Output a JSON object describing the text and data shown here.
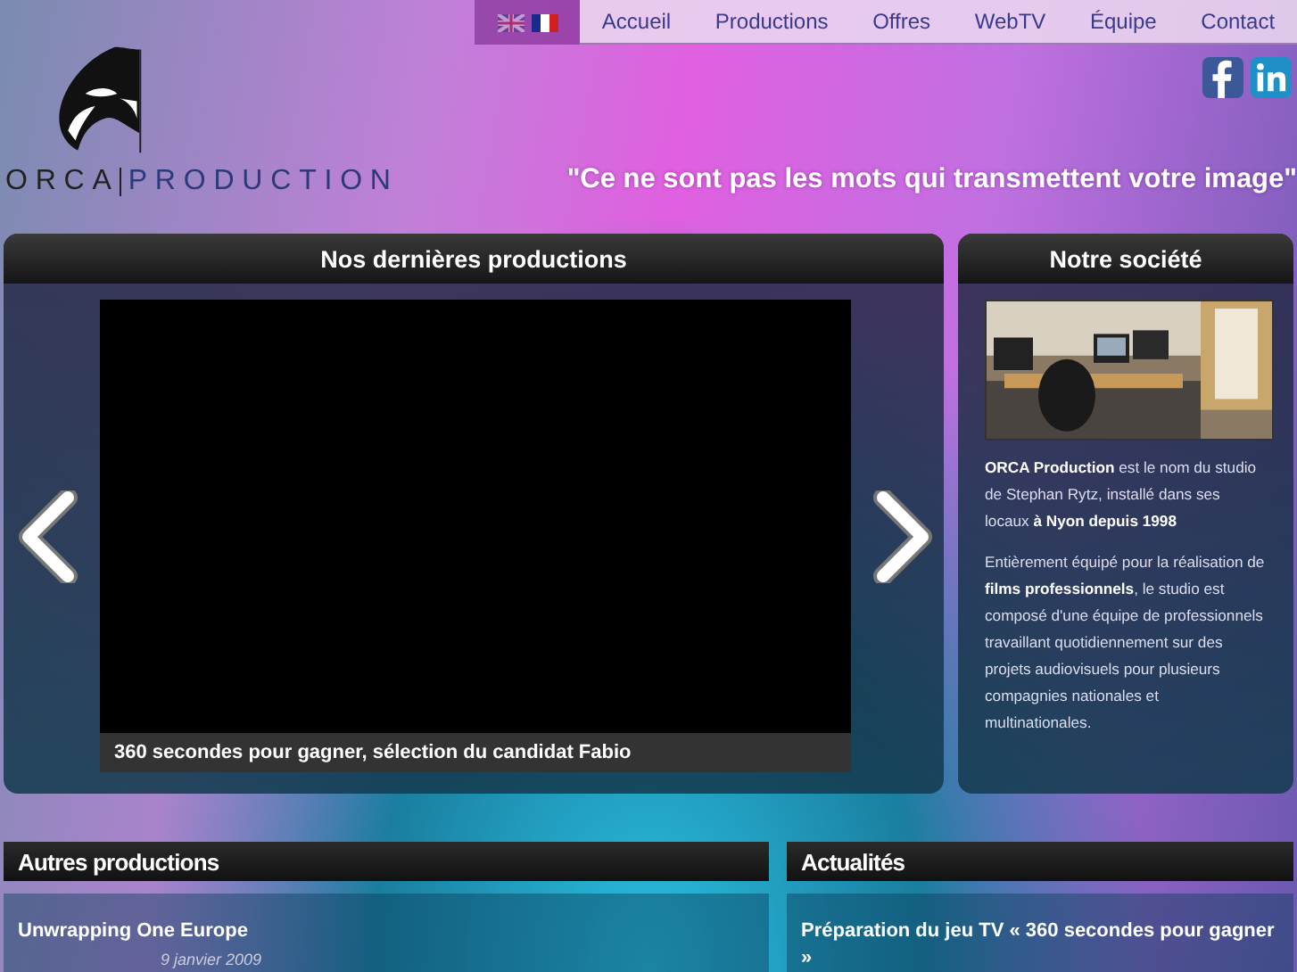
{
  "languages": [
    {
      "kind": "uk",
      "selected": false
    },
    {
      "kind": "fr",
      "selected": true
    }
  ],
  "nav": [
    {
      "label": "Accueil"
    },
    {
      "label": "Productions"
    },
    {
      "label": "Offres"
    },
    {
      "label": "WebTV"
    },
    {
      "label": "Équipe"
    },
    {
      "label": "Contact"
    }
  ],
  "social": [
    {
      "kind": "facebook"
    },
    {
      "kind": "linkedin"
    }
  ],
  "logo": {
    "word1": "ORCA",
    "word2": "PRODUCTION"
  },
  "slogan": "\"Ce ne sont pas les mots qui transmettent votre image\"",
  "latest": {
    "title": "Nos dernières productions",
    "caption": "360 secondes pour gagner, sélection du candidat Fabio"
  },
  "company": {
    "title": "Notre société",
    "paragraphs": [
      "**ORCA Production** est le nom du studio de Stephan Rytz, installé dans ses locaux **à Nyon depuis 1998**",
      "Entièrement équipé pour la réalisation de **films professionnels**, le studio est composé d'une équipe de professionnels travaillant quotidiennement sur des projets audiovisuels pour plusieurs compagnies nationales et multinationales."
    ]
  },
  "other": {
    "title": "Autres productions",
    "item_title": "Unwrapping One Europe",
    "date": "9 janvier 2009"
  },
  "news": {
    "title": "Actualités",
    "item_title": "Préparation du jeu TV « 360 secondes pour gagner »"
  }
}
